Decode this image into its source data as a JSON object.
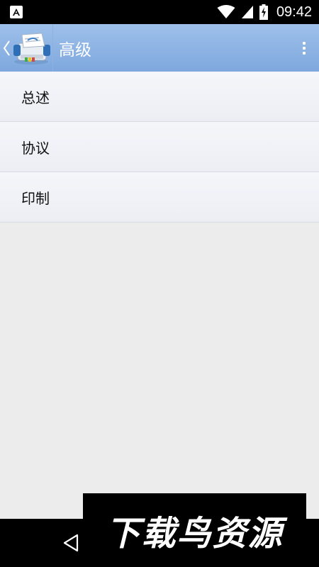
{
  "status_bar": {
    "notification_icon": "android-notification-icon",
    "time": "09:42",
    "icons": [
      "wifi-icon",
      "cell-signal-icon",
      "battery-charging-icon"
    ]
  },
  "action_bar": {
    "title": "高级",
    "app_icon": "printer-icon",
    "up_icon": "chevron-left-icon",
    "overflow_icon": "overflow-menu-icon",
    "color": "#8db4e5"
  },
  "list": {
    "items": [
      {
        "label": "总述"
      },
      {
        "label": "协议"
      },
      {
        "label": "印制"
      }
    ]
  },
  "nav_bar": {
    "back_icon": "nav-back-icon"
  },
  "watermark": {
    "text": "下载鸟资源"
  }
}
